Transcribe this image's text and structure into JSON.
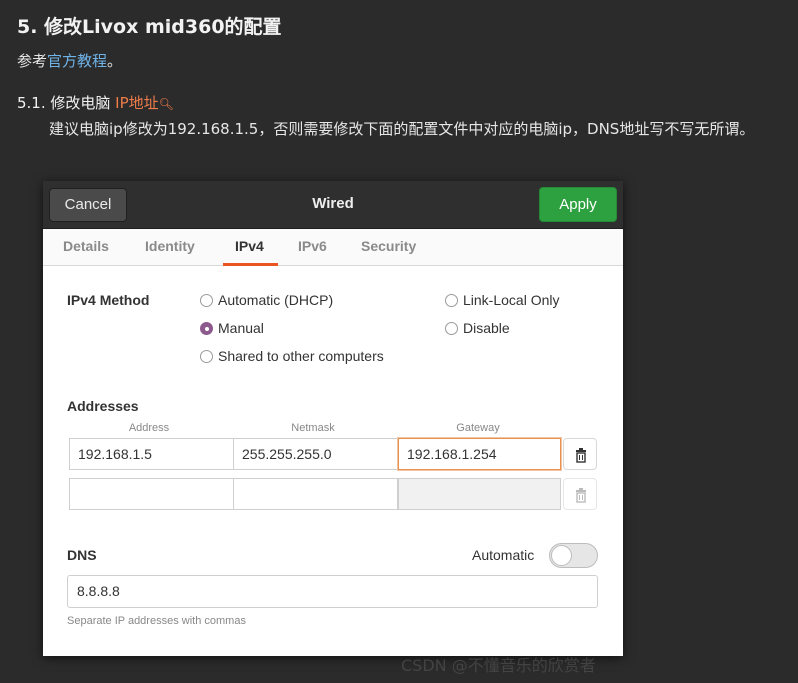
{
  "article": {
    "heading": "5. 修改Livox mid360的配置",
    "ref_prefix": "参考",
    "ref_link": "官方教程",
    "ref_suffix": "。",
    "subheading_prefix": "5.1. 修改电脑 ",
    "subheading_ip": "IP地址",
    "subheading_icon": "search-icon",
    "note": "建议电脑ip修改为192.168.1.5，否则需要修改下面的配置文件中对应的电脑ip，DNS地址写不写无所谓。"
  },
  "dialog": {
    "cancel_label": "Cancel",
    "title": "Wired",
    "apply_label": "Apply",
    "tabs": [
      {
        "label": "Details",
        "active": false
      },
      {
        "label": "Identity",
        "active": false
      },
      {
        "label": "IPv4",
        "active": true
      },
      {
        "label": "IPv6",
        "active": false
      },
      {
        "label": "Security",
        "active": false
      }
    ],
    "ipv4_method_label": "IPv4 Method",
    "methods": {
      "automatic": {
        "label": "Automatic (DHCP)",
        "selected": false
      },
      "manual": {
        "label": "Manual",
        "selected": true
      },
      "shared": {
        "label": "Shared to other computers",
        "selected": false
      },
      "link_local": {
        "label": "Link-Local Only",
        "selected": false
      },
      "disable": {
        "label": "Disable",
        "selected": false
      }
    },
    "addresses_label": "Addresses",
    "columns": [
      "Address",
      "Netmask",
      "Gateway"
    ],
    "rows": [
      {
        "address": "192.168.1.5",
        "netmask": "255.255.255.0",
        "gateway": "192.168.1.254"
      },
      {
        "address": "",
        "netmask": "",
        "gateway": ""
      }
    ],
    "dns_label": "DNS",
    "dns_automatic_label": "Automatic",
    "dns_automatic_on": false,
    "dns_value": "8.8.8.8",
    "dns_hint": "Separate IP addresses with commas"
  },
  "watermark": "CSDN @不懂音乐的欣赏者",
  "colors": {
    "page_bg": "#2b2b2b",
    "link": "#6fb3e8",
    "highlight": "#f07c4a",
    "apply_green": "#2da140",
    "tab_accent": "#e95420",
    "radio_selected": "#8c5a8d"
  }
}
